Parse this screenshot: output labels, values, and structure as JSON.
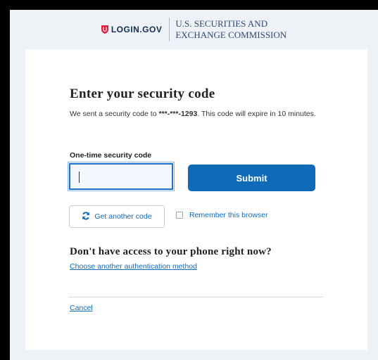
{
  "header": {
    "logo_text": "LOGIN.GOV",
    "agency_line1": "U.S. SECURITIES AND",
    "agency_line2": "EXCHANGE COMMISSION"
  },
  "form": {
    "title": "Enter your security code",
    "description_prefix": "We sent a security code to ",
    "phone_mask": "***-***-",
    "phone_last4": "1293",
    "description_suffix": ". This code will expire in 10 minutes.",
    "code_label": "One-time security code",
    "code_value": "",
    "submit_label": "Submit",
    "get_another_label": "Get another code",
    "remember_label": "Remember this browser",
    "remember_checked": false
  },
  "alternate": {
    "heading": "Don't have access to your phone right now?",
    "link_label": "Choose another authentication method"
  },
  "cancel_label": "Cancel",
  "colors": {
    "brand_red": "#e21c3d",
    "link_blue": "#0f6bb8",
    "button_blue": "#0f6bb8",
    "page_background": "#eef2f7"
  },
  "icons": {
    "logo": "shield-icon",
    "refresh": "refresh-icon"
  }
}
